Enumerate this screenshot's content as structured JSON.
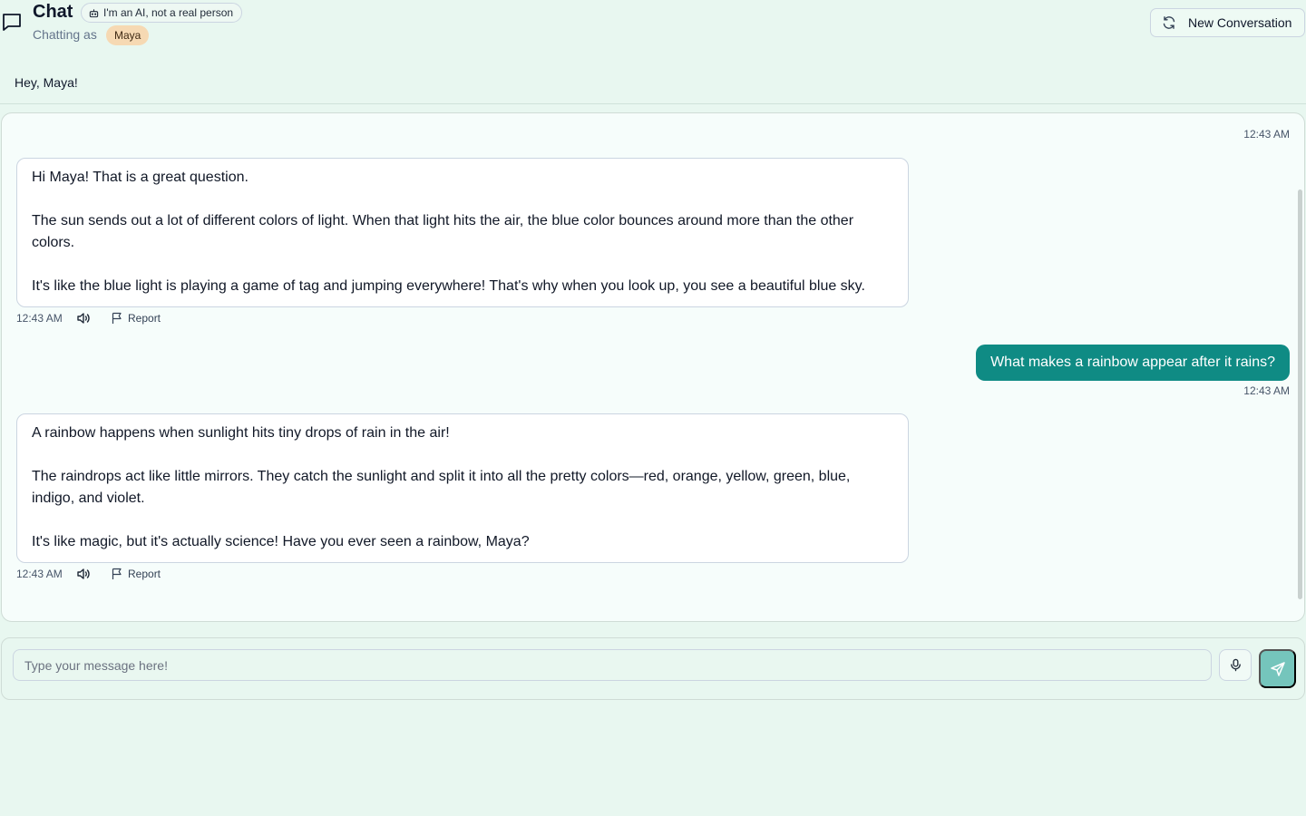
{
  "header": {
    "title": "Chat",
    "ai_badge": "I'm an AI, not a real person",
    "chatting_as_label": "Chatting as",
    "user_name": "Maya",
    "new_conversation_label": "New Conversation"
  },
  "greeting": "Hey, Maya!",
  "messages": [
    {
      "role": "assistant",
      "paragraphs": [
        "Hi Maya! That is a great question.",
        "The sun sends out a lot of different colors of light. When that light hits the air, the blue color bounces around more than the other colors.",
        "It's like the blue light is playing a game of tag and jumping everywhere! That's why when you look up, you see a beautiful blue sky."
      ],
      "time": "12:43 AM",
      "report_label": "Report"
    },
    {
      "role": "user",
      "text": "What makes a rainbow appear after it rains?",
      "time": "12:43 AM"
    },
    {
      "role": "assistant",
      "paragraphs": [
        "A rainbow happens when sunlight hits tiny drops of rain in the air!",
        "The raindrops act like little mirrors. They catch the sunlight and split it into all the pretty colors—red, orange, yellow, green, blue, indigo, and violet.",
        "It's like magic, but it's actually science! Have you ever seen a rainbow, Maya?"
      ],
      "time": "12:43 AM",
      "report_label": "Report"
    }
  ],
  "top_timestamp": "12:43 AM",
  "composer": {
    "placeholder": "Type your message here!",
    "value": ""
  },
  "icons": {
    "header": "chat-bubble-icon",
    "badge": "bot-icon",
    "new_conversation": "refresh-icon",
    "speaker": "speaker-icon",
    "report": "flag-icon",
    "mic": "mic-icon",
    "send": "send-icon"
  },
  "colors": {
    "background": "#e8f7f0",
    "accent": "#0f8b84",
    "send_button": "#75c5bc",
    "user_pill": "#f6d9b3"
  }
}
